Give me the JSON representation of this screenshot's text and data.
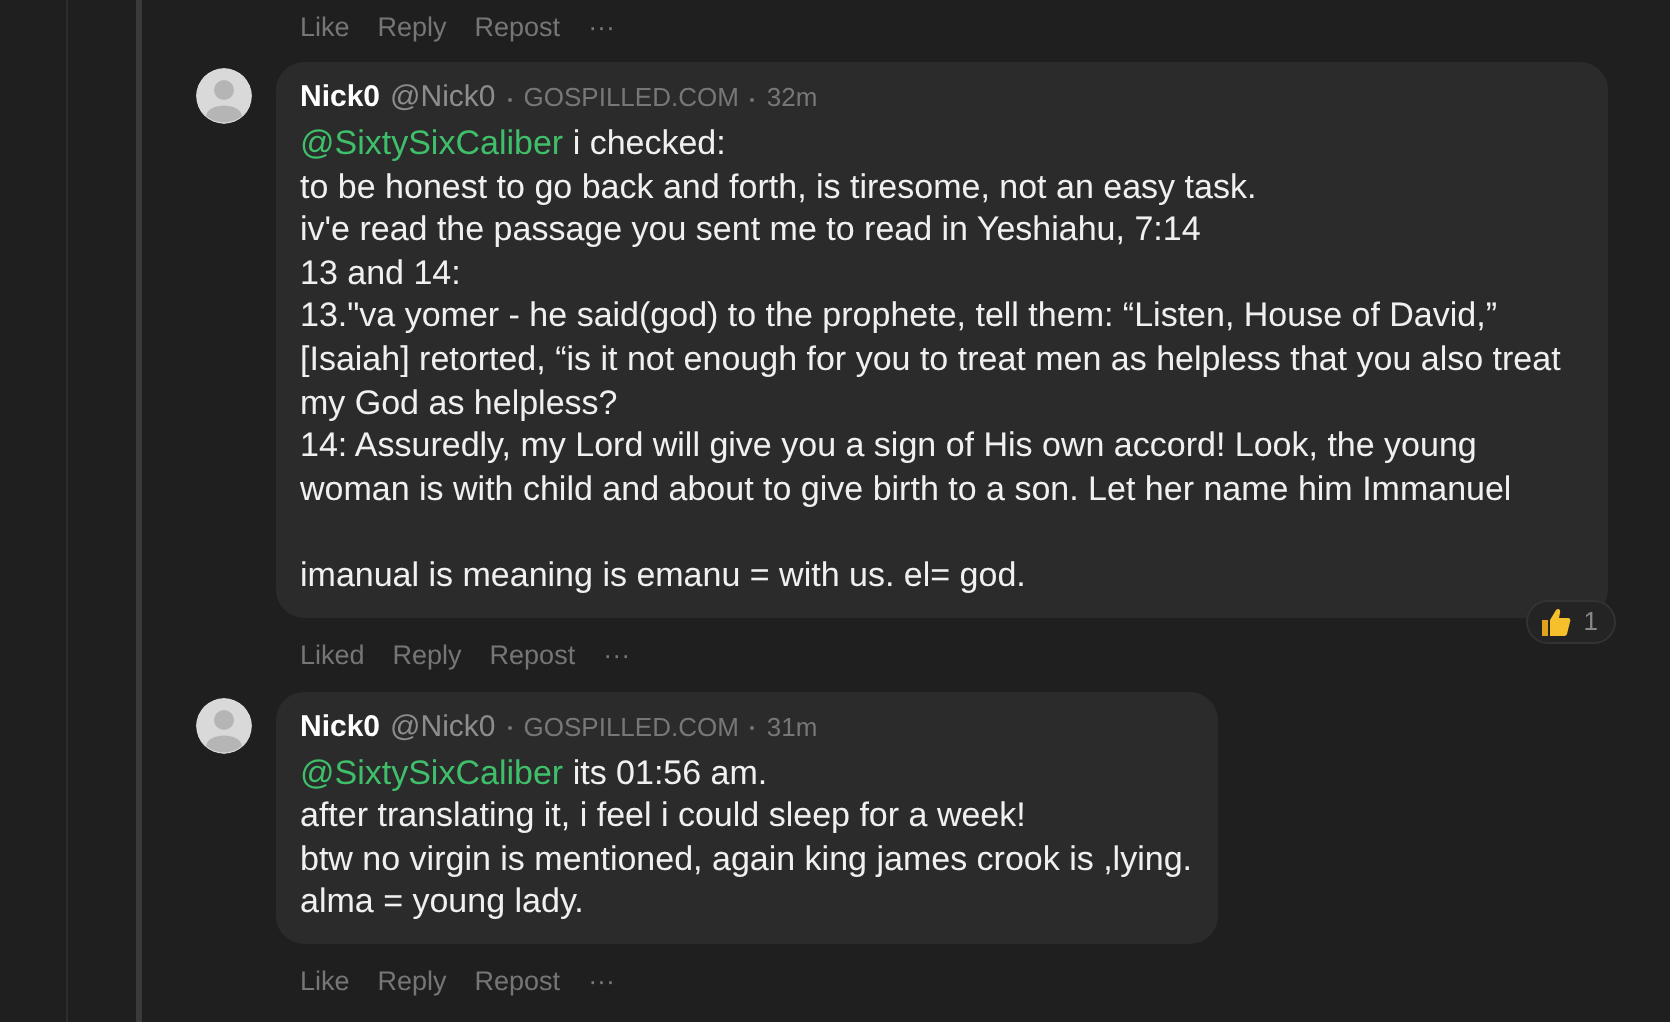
{
  "top_actions": [
    "Like",
    "Reply",
    "Repost",
    "···"
  ],
  "comments": [
    {
      "author": "Nick0",
      "handle": "@Nick0",
      "site": "GOSPILLED.COM",
      "time": "32m",
      "mention": "@SixtySixCaliber",
      "text": "i checked:\nto be honest to go back and forth, is tiresome, not an easy task.\niv'e read the passage you sent me to read in Yeshiahu, 7:14\n13 and 14:\n13.\"va yomer - he said(god) to the prophete, tell them: “Listen, House of David,” [Isaiah] retorted, “is it not enough for you to treat men as helpless that you also treat my God as helpless?\n14: Assuredly, my Lord will give you a sign of His own accord! Look, the young woman is with child and about to give birth to a son. Let her name him Immanuel\n\nimanual is meaning is emanu = with us. el= god.",
      "reaction": {
        "count": "1"
      },
      "actions": [
        "Liked",
        "Reply",
        "Repost",
        "···"
      ]
    },
    {
      "author": "Nick0",
      "handle": "@Nick0",
      "site": "GOSPILLED.COM",
      "time": "31m",
      "mention": "@SixtySixCaliber",
      "text": "its 01:56 am.\nafter translating it, i feel i could sleep for a week!\nbtw no virgin is mentioned, again king james crook is ,lying.\nalma = young lady.",
      "actions": [
        "Like",
        "Reply",
        "Repost",
        "···"
      ]
    }
  ]
}
